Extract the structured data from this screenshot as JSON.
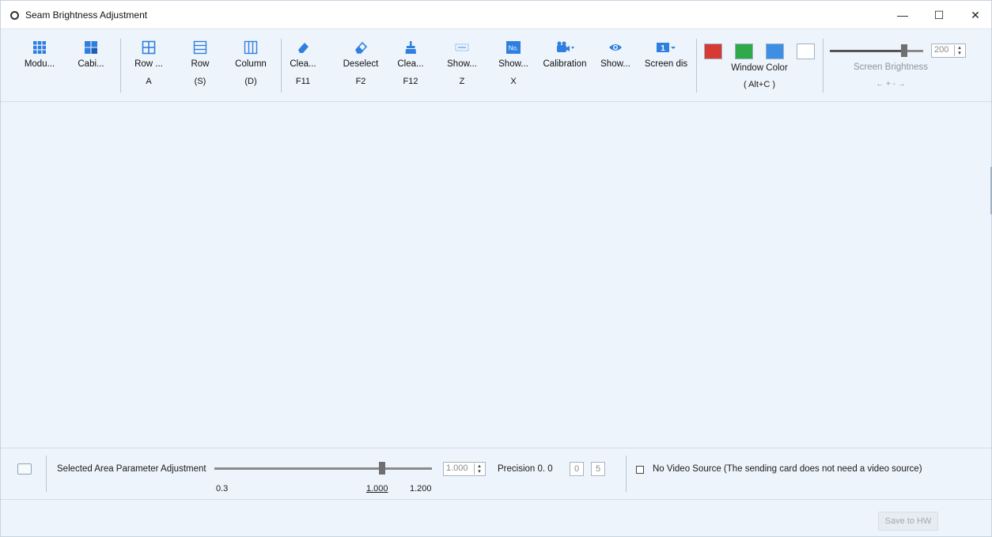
{
  "window": {
    "title": "Seam Brightness Adjustment",
    "minimize_glyph": "—",
    "maximize_glyph": "☐",
    "close_glyph": "✕"
  },
  "toolbar": {
    "tools": [
      {
        "name": "module",
        "label": "Modu...",
        "key": "",
        "icon": "module-grid-icon"
      },
      {
        "name": "cabinet",
        "label": "Cabi...",
        "key": "",
        "icon": "cabinet-icon"
      },
      {
        "name": "row-select",
        "label": "Row ...",
        "key": "A",
        "icon": "row-grid-icon"
      },
      {
        "name": "row",
        "label": "Row",
        "key": "(S)",
        "icon": "row-lines-icon"
      },
      {
        "name": "column",
        "label": "Column",
        "key": "(D)",
        "icon": "column-lines-icon"
      },
      {
        "name": "clear",
        "label": "Clea...",
        "key": "F11",
        "icon": "eraser-icon"
      },
      {
        "name": "deselect",
        "label": "Deselect",
        "key": "F2",
        "icon": "eraser-outline-icon"
      },
      {
        "name": "clear-all",
        "label": "Clea...",
        "key": "F12",
        "icon": "broom-icon"
      },
      {
        "name": "show-seam",
        "label": "Show...",
        "key": "Z",
        "icon": "dashed-rect-icon"
      },
      {
        "name": "show-number",
        "label": "Show...",
        "key": "X",
        "icon": "number-badge-icon"
      },
      {
        "name": "calibration",
        "label": "Calibration",
        "key": "",
        "icon": "calibration-icon"
      },
      {
        "name": "show-eye",
        "label": "Show...",
        "key": "",
        "icon": "eye-icon"
      },
      {
        "name": "screen-dis",
        "label": "Screen dis",
        "key": "",
        "icon": "screen-number-icon"
      }
    ],
    "window_color": {
      "label": "Window Color",
      "shortcut": "( Alt+C )",
      "swatches": [
        "#d63a32",
        "#2fa94a",
        "#3d8fe6",
        "#ffffff"
      ]
    },
    "screen_brightness": {
      "label": "Screen Brightness",
      "value": "200",
      "fraction": 0.8,
      "arrows": "← +   - →"
    }
  },
  "bottom": {
    "param_label": "Selected Area Parameter Adjustment",
    "value_box": "1.000",
    "min": "0.3",
    "current": "1.000",
    "max": "1.200",
    "fraction": 0.77,
    "precision_label": "Precision   0. 0",
    "precision_box1": "0",
    "precision_box2": "5",
    "no_video_label": "No Video Source (The sending card does not need a video source)",
    "no_video_checked": false
  },
  "footer": {
    "save_label": "Save to HW"
  },
  "colors": {
    "background": "#eef4fb",
    "icon_blue": "#2f7fe0"
  }
}
